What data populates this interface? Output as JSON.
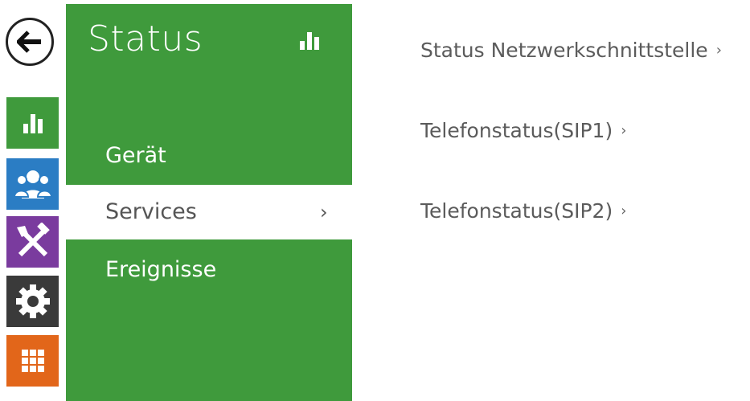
{
  "sidebar": {
    "back": {
      "icon": "back-arrow-icon"
    },
    "rail": [
      {
        "name": "status",
        "icon": "bar-chart-icon",
        "color": "#3f9a3c"
      },
      {
        "name": "directory",
        "icon": "users-icon",
        "color": "#2b7dc4"
      },
      {
        "name": "hardware",
        "icon": "tools-icon",
        "color": "#7a3b9e"
      },
      {
        "name": "system",
        "icon": "gear-icon",
        "color": "#3a3a3a"
      },
      {
        "name": "services",
        "icon": "grid-icon",
        "color": "#e2661a"
      }
    ]
  },
  "panel": {
    "title": "Status",
    "title_icon": "bar-chart-icon",
    "color": "#3f9a3c",
    "items": [
      {
        "label": "Gerät"
      },
      {
        "label": "Services",
        "chevron": "›",
        "active": true
      },
      {
        "label": "Ereignisse"
      }
    ]
  },
  "content": {
    "links": [
      {
        "label": "Status Netzwerkschnittstelle",
        "chevron": "›"
      },
      {
        "label": "Telefonstatus(SIP1)",
        "chevron": "›"
      },
      {
        "label": "Telefonstatus(SIP2)",
        "chevron": "›"
      }
    ]
  }
}
